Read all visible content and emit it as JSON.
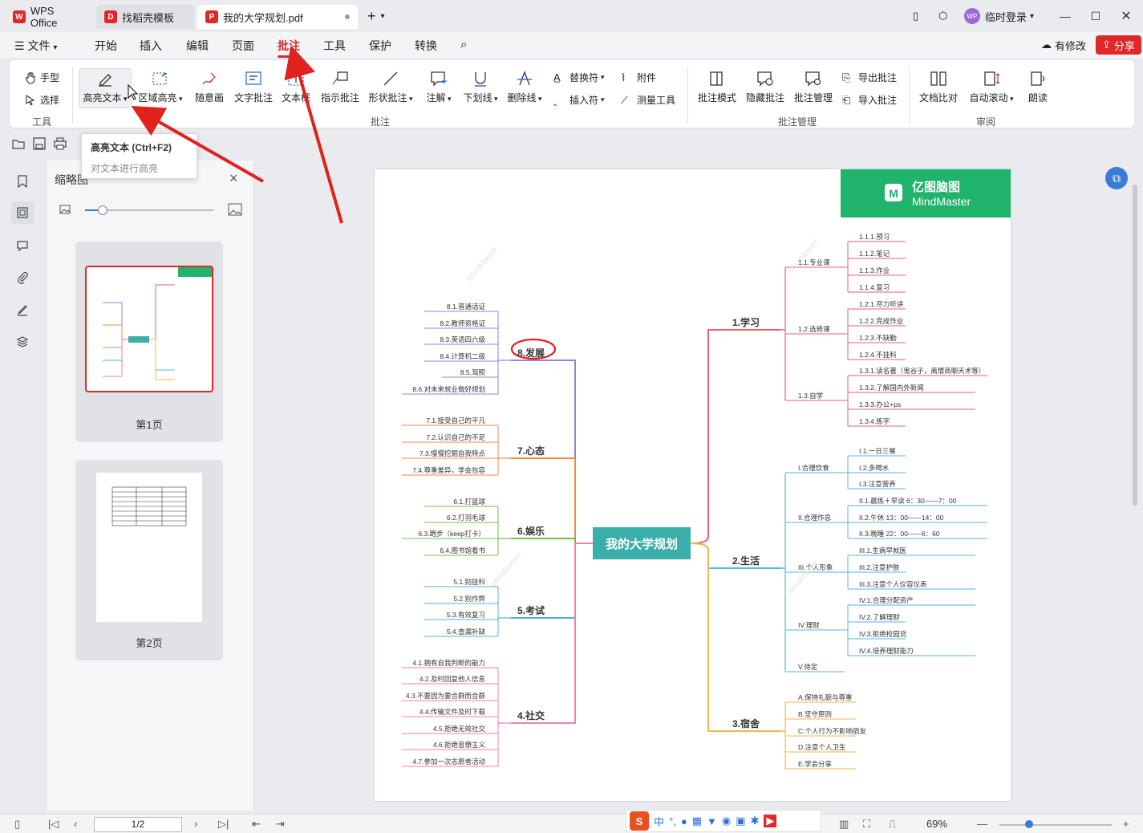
{
  "tabs": [
    {
      "label": "WPS Office",
      "icon": "wps-logo",
      "color": "#e0282a"
    },
    {
      "label": "找稻壳模板",
      "icon": "docer-logo",
      "color": "#e0282a"
    },
    {
      "label": "我的大学规划.pdf",
      "icon": "pdf-logo",
      "color": "#e0282a"
    }
  ],
  "titlebar": {
    "login": "临时登录",
    "avatar": "WP",
    "add_tab": "+"
  },
  "menu": {
    "file": "文件",
    "items": [
      "开始",
      "插入",
      "编辑",
      "页面",
      "批注",
      "工具",
      "保护",
      "转换"
    ],
    "active": "批注",
    "modified": "有修改",
    "share": "分享"
  },
  "ribbon": {
    "tools_group": {
      "label": "工具",
      "hand": "手型",
      "select": "选择"
    },
    "annot_group": {
      "label": "批注",
      "buttons": [
        "高亮文本",
        "区域高亮",
        "随意画",
        "文字批注",
        "文本框",
        "指示批注",
        "形状批注",
        "注解",
        "下划线",
        "删除线"
      ],
      "small": [
        "替换符",
        "插入符",
        "附件",
        "测量工具"
      ]
    },
    "manage_group": {
      "label": "批注管理",
      "buttons": [
        "批注模式",
        "隐藏批注",
        "批注管理"
      ],
      "small": [
        "导出批注",
        "导入批注"
      ]
    },
    "review_group": {
      "label": "审阅",
      "buttons": [
        "文档比对",
        "自动滚动",
        "朗读"
      ]
    }
  },
  "tooltip": {
    "title": "高亮文本 (Ctrl+F2)",
    "desc": "对文本进行高亮"
  },
  "thumbnail": {
    "title": "缩略图",
    "pages": [
      "第1页",
      "第2页"
    ],
    "zoom_fraction": 0.13
  },
  "statusbar": {
    "page": "1/2",
    "zoom": "69%"
  },
  "watermark": {
    "brand": "亿图脑图",
    "brand_en": "MindMaster"
  },
  "mindmap": {
    "center": "我的大学规划",
    "right": [
      {
        "title": "1.学习",
        "color": "#e8636b",
        "children": [
          {
            "label": "1.1.专业课",
            "leaves": [
              "1.1.1.预习",
              "1.1.2.笔记",
              "1.1.3.作业",
              "1.1.4.复习"
            ]
          },
          {
            "label": "1.2.选修课",
            "leaves": [
              "1.2.1.尽力听讲",
              "1.2.2.完成作业",
              "1.2.3.不缺勤",
              "1.2.4.不挂科"
            ]
          },
          {
            "label": "1.3.自学",
            "leaves": [
              "1.3.1.读名著（鬼谷子，离情商聊天术等）",
              "1.3.2.了解国内外新闻",
              "1.3.3.办公+ps",
              "1.3.4.练字"
            ]
          }
        ]
      },
      {
        "title": "2.生活",
        "color": "#5bb3e0",
        "children": [
          {
            "label": "I.合理饮食",
            "leaves": [
              "I.1.一日三餐",
              "I.2.多喝水",
              "I.3.注意营养"
            ]
          },
          {
            "label": "II.合理作息",
            "leaves": [
              "II.1.晨练＋早读 6：30——7：00",
              "II.2.午休 13：00——14：00",
              "II.3.晚睡 22：00——6：60"
            ]
          },
          {
            "label": "III.个人形象",
            "leaves": [
              "III.1.生病早就医",
              "III.2.注意护肤",
              "III.3.注意个人仪容仪表"
            ]
          },
          {
            "label": "IV.理财",
            "leaves": [
              "IV.1.合理分配资产",
              "IV.2.了解理财",
              "IV.3.拒绝校园贷",
              "IV.4.培养理财能力"
            ]
          },
          {
            "label": "V.待定",
            "leaves": []
          }
        ]
      },
      {
        "title": "3.宿舍",
        "color": "#f2b94a",
        "children": [
          {
            "label": "A.保持礼貌与尊重",
            "leaves": []
          },
          {
            "label": "B.坚守原则",
            "leaves": []
          },
          {
            "label": "C.个人行为不影响宿友",
            "leaves": []
          },
          {
            "label": "D.注意个人卫生",
            "leaves": []
          },
          {
            "label": "E.学会分享",
            "leaves": []
          }
        ]
      }
    ],
    "left": [
      {
        "title": "8.发展",
        "color": "#9b7fd4",
        "leaves": [
          "8.1.普通话证",
          "8.2.教师资格证",
          "8.3.英语四六级",
          "8.4.计算机二级",
          "8.5.驾照",
          "8.6.对未来就业做好规划"
        ]
      },
      {
        "title": "7.心态",
        "color": "#f08a4b",
        "leaves": [
          "7.1.接受自己的平凡",
          "7.2.认识自己的不足",
          "7.3.慢慢挖掘自我特点",
          "7.4.尊重差异，学会包容"
        ]
      },
      {
        "title": "6.娱乐",
        "color": "#6cc04a",
        "leaves": [
          "6.1.打篮球",
          "6.2.打羽毛球",
          "6.3.跑步（keep打卡）",
          "6.4.图书馆看书"
        ]
      },
      {
        "title": "5.考试",
        "color": "#4ab6d6",
        "leaves": [
          "5.1.别挂科",
          "5.2.别作弊",
          "5.3.有效复习",
          "5.4.查漏补缺"
        ]
      },
      {
        "title": "4.社交",
        "color": "#f07fb8",
        "leaves": [
          "4.1.拥有自我判断的能力",
          "4.2.及时回复他人信息",
          "4.3.不要因为要合群而合群",
          "4.4.传输文件及时下载",
          "4.5.拒绝无效社交",
          "4.6.拒绝官僚主义",
          "4.7.参加一次志愿者活动"
        ]
      }
    ]
  },
  "colors": {
    "accent": "#e0282a",
    "center_fill": "#3aafa9",
    "brand_green": "#1fb36b"
  }
}
